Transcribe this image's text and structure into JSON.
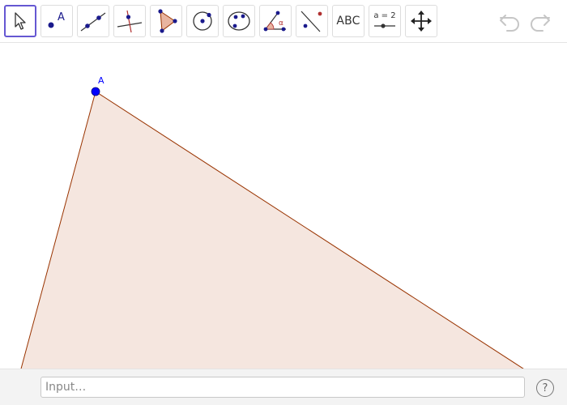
{
  "toolbar": {
    "tools": [
      {
        "name": "move-tool"
      },
      {
        "name": "point-tool",
        "label": "A"
      },
      {
        "name": "line-tool"
      },
      {
        "name": "perpendicular-line-tool"
      },
      {
        "name": "polygon-tool"
      },
      {
        "name": "circle-tool"
      },
      {
        "name": "conic-tool"
      },
      {
        "name": "angle-tool",
        "label": "α"
      },
      {
        "name": "reflect-tool"
      },
      {
        "name": "text-tool",
        "label": "ABC"
      },
      {
        "name": "slider-tool",
        "label": "a = 2"
      },
      {
        "name": "move-graphics-view-tool"
      }
    ],
    "active_tool": "move-tool",
    "undo": "undo",
    "redo": "redo"
  },
  "canvas": {
    "point": {
      "label": "A",
      "color": "#0000ff"
    },
    "polygon": {
      "fill": "#f5e6df",
      "stroke": "#993300"
    }
  },
  "input_bar": {
    "placeholder": "Input…",
    "help": "?"
  },
  "colors": {
    "accent": "#6557d2",
    "point": "#0000ff",
    "polygon_stroke": "#993300",
    "polygon_fill": "#f5e6df"
  }
}
